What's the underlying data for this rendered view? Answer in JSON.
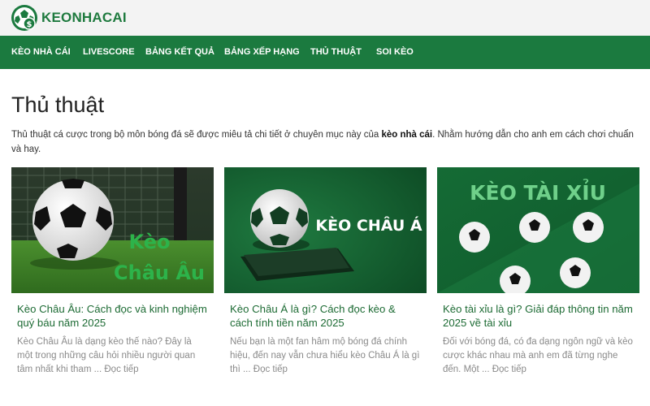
{
  "brand": {
    "name": "KEONHACAI"
  },
  "nav": {
    "items": [
      {
        "label": "KÈO NHÀ CÁI"
      },
      {
        "label": "LIVESCORE"
      },
      {
        "label": "BẢNG KẾT QUẢ"
      },
      {
        "label": "BẢNG XẾP HẠNG"
      },
      {
        "label": "THỦ THUẬT"
      },
      {
        "label": "SOI KÈO"
      }
    ]
  },
  "page": {
    "title": "Thủ thuật",
    "intro_before": "Thủ thuật cá cược trong bộ môn bóng đá sẽ được miêu tả chi tiết ở chuyên mục này của ",
    "intro_bold": "kèo nhà cái",
    "intro_after": ". Nhằm hướng dẫn cho anh em cách chơi chuẩn và hay."
  },
  "articles": [
    {
      "image_text_line1": "Kèo",
      "image_text_line2": "Châu Âu",
      "title": "Kèo Châu Âu: Cách đọc và kinh nghiệm quý báu năm 2025",
      "excerpt": "Kèo Châu Âu là dạng kèo thế nào? Đây là một trong những câu hỏi nhiều người quan tâm nhất khi tham ... Đọc tiếp"
    },
    {
      "image_text": "KÈO CHÂU Á",
      "title": "Kèo Châu Á là gì? Cách đọc kèo & cách tính tiền năm 2025",
      "excerpt": "Nếu bạn là một fan hâm mộ bóng đá chính hiệu, đến nay vẫn chưa hiểu kèo Châu Á là gì thì ... Đọc tiếp"
    },
    {
      "image_text": "KÈO TÀI XỈU",
      "title": "Kèo tài xỉu là gì? Giải đáp thông tin năm 2025 về tài xỉu",
      "excerpt": "Đối với bóng đá, có đa dạng ngôn ngữ và kèo cược khác nhau mà anh em đã từng nghe đến. Một ... Đọc tiếp"
    }
  ],
  "colors": {
    "brand_green": "#1b7a3f",
    "title_green": "#1d6b34",
    "topbar": "#f3f3f3"
  },
  "icons": {
    "logo": "soccer-ball-dollar-icon"
  }
}
